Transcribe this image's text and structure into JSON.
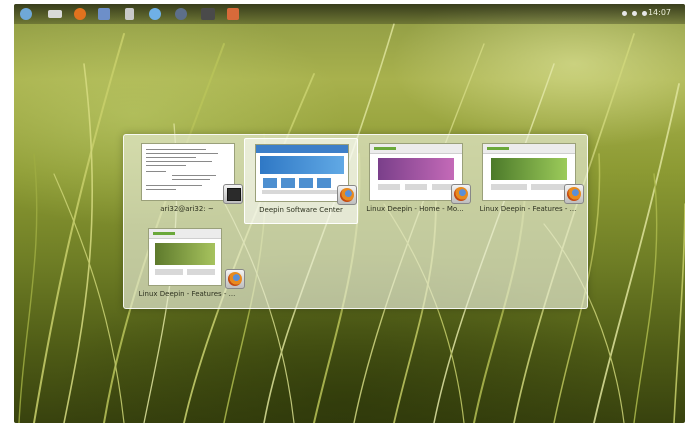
{
  "panel": {
    "launcher_icons": [
      {
        "name": "deepin-launcher-icon",
        "color": "#6fa8d8"
      },
      {
        "name": "keyboard-icon",
        "color": "#d9d9d9"
      },
      {
        "name": "firefox-icon",
        "color": "#e0721e"
      },
      {
        "name": "software-center-icon",
        "color": "#6d8fc9"
      },
      {
        "name": "file-manager-icon",
        "color": "#c9c9c9"
      },
      {
        "name": "network-icon",
        "color": "#6fb0e6"
      },
      {
        "name": "media-player-icon",
        "color": "#5d6f8a"
      },
      {
        "name": "terminal-icon",
        "color": "#4a4a4a"
      },
      {
        "name": "settings-icon",
        "color": "#d86a3a"
      }
    ],
    "clock": "14:07"
  },
  "switcher": {
    "windows": [
      {
        "title": "ari32@ari32: ~",
        "app_icon": "terminal-icon",
        "selected": false
      },
      {
        "title": "Deepin Software Center",
        "app_icon": "firefox-icon",
        "selected": true
      },
      {
        "title": "Linux Deepin - Home - Mo...",
        "app_icon": "firefox-icon",
        "selected": false
      },
      {
        "title": "Linux Deepin - Features - ...",
        "app_icon": "firefox-icon",
        "selected": false
      },
      {
        "title": "Linux Deepin - Features - ...",
        "app_icon": "firefox-icon",
        "selected": false
      }
    ]
  },
  "colors": {
    "switcher_bg": "#e8ecd6",
    "wallpaper_dark": "#38420e",
    "wallpaper_light": "#a8b14d"
  }
}
